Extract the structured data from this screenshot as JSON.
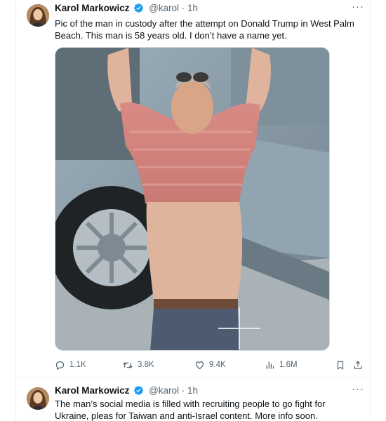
{
  "tweets": [
    {
      "author": "Karol Markowicz",
      "handle": "@karol",
      "separator": " · ",
      "time": "1h",
      "text": "Pic of the man in custody after the attempt on Donald Trump in West Palm Beach. This man is 58 years old. I don’t have a name yet.",
      "stats": {
        "replies": "1.1K",
        "reposts": "3.8K",
        "likes": "9.4K",
        "views": "1.6M"
      }
    },
    {
      "author": "Karol Markowicz",
      "handle": "@karol",
      "separator": " · ",
      "time": "1h",
      "text": "The man’s social media is filled with recruiting people to go fight for Ukraine, pleas for Taiwan and anti-Israel content. More info soon."
    }
  ],
  "icons": {
    "verified": "verified-badge-icon",
    "more": "more-horizontal-icon",
    "reply": "reply-icon",
    "repost": "repost-icon",
    "like": "heart-icon",
    "views": "views-chart-icon",
    "bookmark": "bookmark-icon",
    "share": "share-icon"
  },
  "colors": {
    "text": "#0f1419",
    "secondary": "#536471",
    "verified": "#1d9bf0",
    "border": "#eff3f4"
  }
}
